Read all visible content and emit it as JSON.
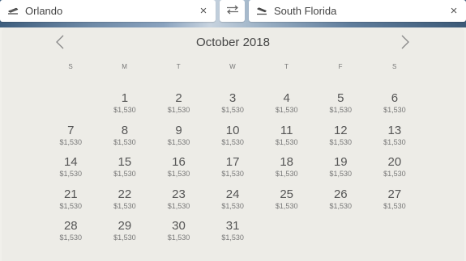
{
  "search": {
    "origin": "Orlando",
    "destination": "South Florida",
    "clear_symbol": "×"
  },
  "calendar": {
    "month_title": "October 2018",
    "weekdays": [
      "S",
      "M",
      "T",
      "W",
      "T",
      "F",
      "S"
    ],
    "first_weekday_index": 1,
    "days": [
      {
        "day": "1",
        "price": "$1,530"
      },
      {
        "day": "2",
        "price": "$1,530"
      },
      {
        "day": "3",
        "price": "$1,530"
      },
      {
        "day": "4",
        "price": "$1,530"
      },
      {
        "day": "5",
        "price": "$1,530"
      },
      {
        "day": "6",
        "price": "$1,530"
      },
      {
        "day": "7",
        "price": "$1,530"
      },
      {
        "day": "8",
        "price": "$1,530"
      },
      {
        "day": "9",
        "price": "$1,530"
      },
      {
        "day": "10",
        "price": "$1,530"
      },
      {
        "day": "11",
        "price": "$1,530"
      },
      {
        "day": "12",
        "price": "$1,530"
      },
      {
        "day": "13",
        "price": "$1,530"
      },
      {
        "day": "14",
        "price": "$1,530"
      },
      {
        "day": "15",
        "price": "$1,530"
      },
      {
        "day": "16",
        "price": "$1,530"
      },
      {
        "day": "17",
        "price": "$1,530"
      },
      {
        "day": "18",
        "price": "$1,530"
      },
      {
        "day": "19",
        "price": "$1,530"
      },
      {
        "day": "20",
        "price": "$1,530"
      },
      {
        "day": "21",
        "price": "$1,530"
      },
      {
        "day": "22",
        "price": "$1,530"
      },
      {
        "day": "23",
        "price": "$1,530"
      },
      {
        "day": "24",
        "price": "$1,530"
      },
      {
        "day": "25",
        "price": "$1,530"
      },
      {
        "day": "26",
        "price": "$1,530"
      },
      {
        "day": "27",
        "price": "$1,530"
      },
      {
        "day": "28",
        "price": "$1,530"
      },
      {
        "day": "29",
        "price": "$1,530"
      },
      {
        "day": "30",
        "price": "$1,530"
      },
      {
        "day": "31",
        "price": "$1,530"
      }
    ]
  },
  "icons": {
    "origin": "plane-takeoff-icon",
    "destination": "plane-landing-icon",
    "swap": "swap-arrows-icon",
    "prev": "chevron-left-icon",
    "next": "chevron-right-icon"
  },
  "colors": {
    "calendar_bg": "#edece7",
    "text": "#555555"
  }
}
